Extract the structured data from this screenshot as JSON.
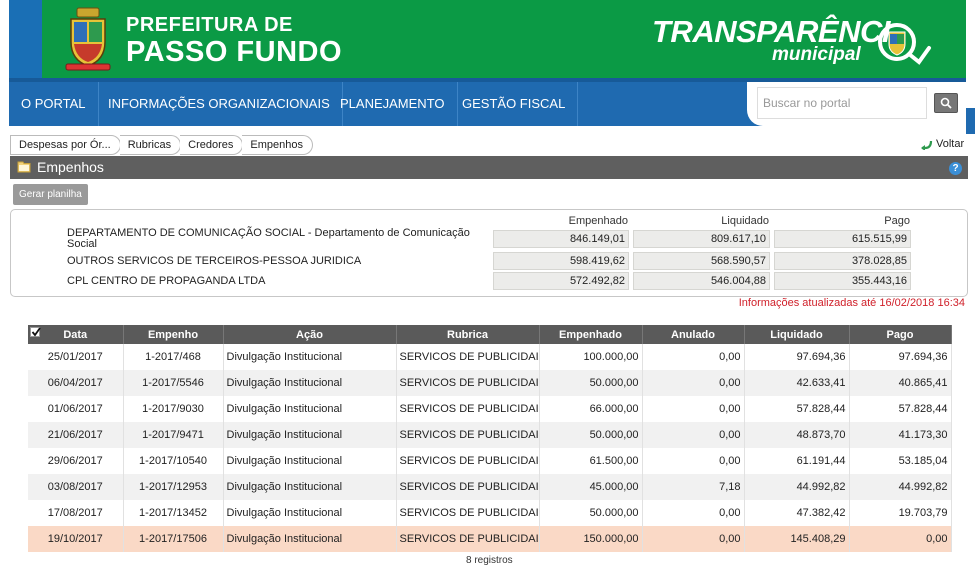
{
  "header": {
    "city_line1": "PREFEITURA DE",
    "city_line2": "PASSO FUNDO",
    "portal_title": "TRANSPARÊNCI",
    "portal_subtitle": "municipal"
  },
  "nav": {
    "items": [
      "O PORTAL",
      "INFORMAÇÕES ORGANIZACIONAIS",
      "PLANEJAMENTO",
      "GESTÃO FISCAL"
    ],
    "search_placeholder": "Buscar no portal"
  },
  "breadcrumb": [
    "Despesas por Ór...",
    "Rubricas",
    "Credores",
    "Empenhos"
  ],
  "voltar_label": "Voltar",
  "panel_title": "Empenhos",
  "help_glyph": "?",
  "gerar_label": "Gerar planilha",
  "summary": {
    "headers": [
      "Empenhado",
      "Liquidado",
      "Pago"
    ],
    "rows": [
      {
        "label": "DEPARTAMENTO DE COMUNICAÇÃO SOCIAL - Departamento de Comunicação Social",
        "values": [
          "846.149,01",
          "809.617,10",
          "615.515,99"
        ]
      },
      {
        "label": "OUTROS SERVICOS DE TERCEIROS-PESSOA JURIDICA",
        "values": [
          "598.419,62",
          "568.590,57",
          "378.028,85"
        ]
      },
      {
        "label": "CPL CENTRO DE PROPAGANDA LTDA",
        "values": [
          "572.492,82",
          "546.004,88",
          "355.443,16"
        ]
      }
    ],
    "updated": "Informações atualizadas até 16/02/2018 16:34"
  },
  "table": {
    "columns": [
      "Data",
      "Empenho",
      "Ação",
      "Rubrica",
      "Empenhado",
      "Anulado",
      "Liquidado",
      "Pago"
    ],
    "rows": [
      [
        "25/01/2017",
        "1-2017/468",
        "Divulgação Institucional",
        "SERVICOS DE PUBLICIDAI",
        "100.000,00",
        "0,00",
        "97.694,36",
        "97.694,36"
      ],
      [
        "06/04/2017",
        "1-2017/5546",
        "Divulgação Institucional",
        "SERVICOS DE PUBLICIDAI",
        "50.000,00",
        "0,00",
        "42.633,41",
        "40.865,41"
      ],
      [
        "01/06/2017",
        "1-2017/9030",
        "Divulgação Institucional",
        "SERVICOS DE PUBLICIDAI",
        "66.000,00",
        "0,00",
        "57.828,44",
        "57.828,44"
      ],
      [
        "21/06/2017",
        "1-2017/9471",
        "Divulgação Institucional",
        "SERVICOS DE PUBLICIDAI",
        "50.000,00",
        "0,00",
        "48.873,70",
        "41.173,30"
      ],
      [
        "29/06/2017",
        "1-2017/10540",
        "Divulgação Institucional",
        "SERVICOS DE PUBLICIDAI",
        "61.500,00",
        "0,00",
        "61.191,44",
        "53.185,04"
      ],
      [
        "03/08/2017",
        "1-2017/12953",
        "Divulgação Institucional",
        "SERVICOS DE PUBLICIDAI",
        "45.000,00",
        "7,18",
        "44.992,82",
        "44.992,82"
      ],
      [
        "17/08/2017",
        "1-2017/13452",
        "Divulgação Institucional",
        "SERVICOS DE PUBLICIDAI",
        "50.000,00",
        "0,00",
        "47.382,42",
        "19.703,79"
      ],
      [
        "19/10/2017",
        "1-2017/17506",
        "Divulgação Institucional",
        "SERVICOS DE PUBLICIDAI",
        "150.000,00",
        "0,00",
        "145.408,29",
        "0,00"
      ]
    ],
    "records_label": "8 registros"
  },
  "colors": {
    "brand_green": "#0b9a45",
    "nav_blue": "#1f6ab0",
    "highlight_row": "#fad9c6",
    "updated_red": "#d0202a"
  }
}
